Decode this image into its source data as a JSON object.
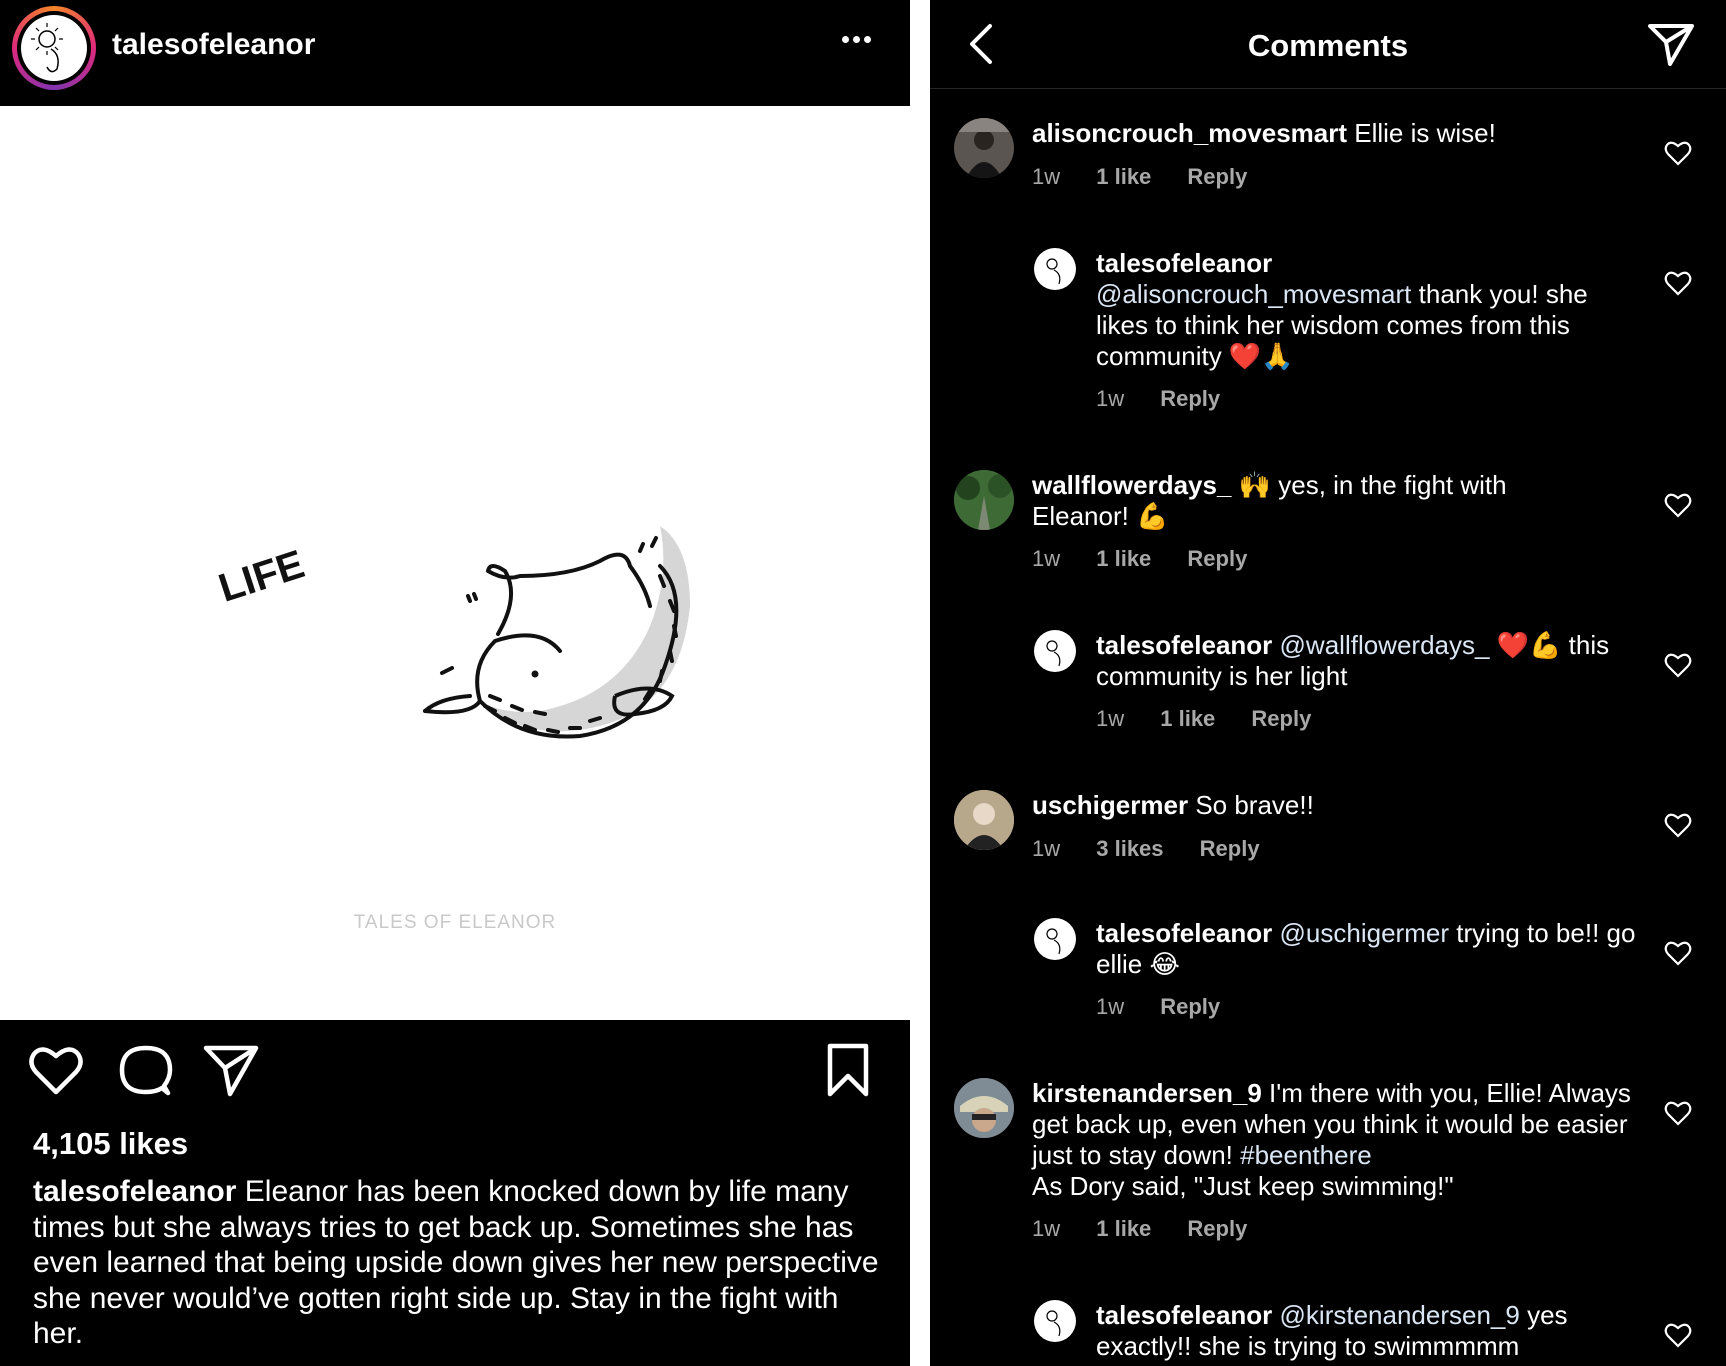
{
  "post": {
    "username": "talesofeleanor",
    "image_text": {
      "word": "LIFE",
      "watermark": "TALES OF ELEANOR"
    },
    "likes": "4,105 likes",
    "caption_user": "talesofeleanor",
    "caption_text": "Eleanor has been knocked down by life many times but she always tries to get back up. Sometimes she has even learned that being upside down gives her new perspective she never would’ve gotten right side up. Stay in the fight with her.",
    "icons": [
      "avatar",
      "more-icon",
      "heart-icon",
      "comment-icon",
      "share-icon",
      "bookmark-icon"
    ]
  },
  "comments_panel": {
    "title": "Comments",
    "icons": [
      "back-icon",
      "send-icon"
    ],
    "comments": [
      {
        "user": "alisoncrouch_movesmart",
        "text": "Ellie is wise!",
        "time": "1w",
        "likes": "1 like",
        "reply": "Reply"
      },
      {
        "user": "talesofeleanor",
        "mention": "@alisoncrouch_movesmart",
        "text": "thank you! she likes to think her wisdom comes from this community ❤️🙏",
        "time": "1w",
        "reply": "Reply"
      },
      {
        "user": "wallflowerdays_",
        "text": "🙌 yes, in the fight with Eleanor! 💪",
        "time": "1w",
        "likes": "1 like",
        "reply": "Reply"
      },
      {
        "user": "talesofeleanor",
        "mention": "@wallflowerdays_",
        "text": "❤️💪 this community is her light",
        "time": "1w",
        "likes": "1 like",
        "reply": "Reply"
      },
      {
        "user": "uschigermer",
        "text": "So brave!!",
        "time": "1w",
        "likes": "3 likes",
        "reply": "Reply"
      },
      {
        "user": "talesofeleanor",
        "mention": "@uschigermer",
        "text": "trying to be!! go ellie 😂",
        "time": "1w",
        "reply": "Reply"
      },
      {
        "user": "kirstenandersen_9",
        "text": "I'm there with you, Ellie! Always get back up, even when you think it would be easier just to stay down!",
        "hashtag": "#beenthere",
        "text2": "As Dory said, \"Just keep swimming!\"",
        "time": "1w",
        "likes": "1 like",
        "reply": "Reply"
      },
      {
        "user": "talesofeleanor",
        "mention": "@kirstenandersen_9",
        "text": "yes exactly!! she is trying to swimmmmm"
      }
    ]
  },
  "colors": {
    "background": "#000000",
    "text": "#ffffff",
    "muted": "#a8a8a8",
    "mention": "#dbe6f5"
  }
}
